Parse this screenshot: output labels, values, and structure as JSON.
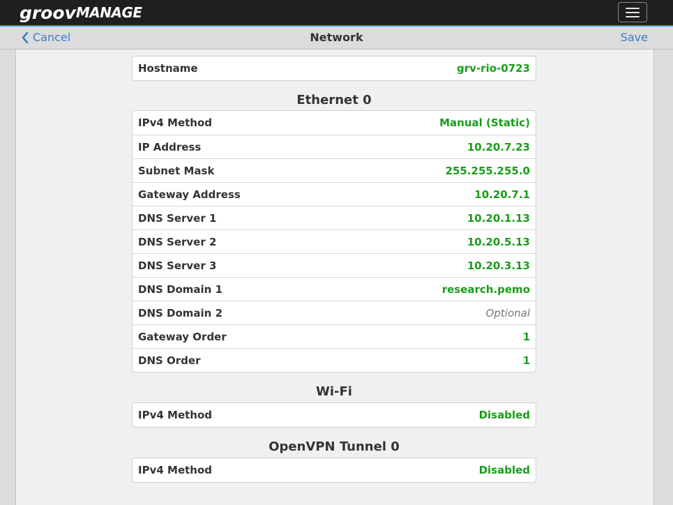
{
  "header": {
    "logo_part1": "groov",
    "logo_part2": "MANAGE"
  },
  "navbar": {
    "cancel_label": "Cancel",
    "title": "Network",
    "save_label": "Save"
  },
  "hostname": {
    "label": "Hostname",
    "value": "grv-rio-0723"
  },
  "ethernet": {
    "title": "Ethernet 0",
    "rows": [
      {
        "label": "IPv4 Method",
        "value": "Manual (Static)"
      },
      {
        "label": "IP Address",
        "value": "10.20.7.23"
      },
      {
        "label": "Subnet Mask",
        "value": "255.255.255.0"
      },
      {
        "label": "Gateway Address",
        "value": "10.20.7.1"
      },
      {
        "label": "DNS Server 1",
        "value": "10.20.1.13"
      },
      {
        "label": "DNS Server 2",
        "value": "10.20.5.13"
      },
      {
        "label": "DNS Server 3",
        "value": "10.20.3.13"
      },
      {
        "label": "DNS Domain 1",
        "value": "research.pemo"
      },
      {
        "label": "DNS Domain 2",
        "placeholder": "Optional"
      },
      {
        "label": "Gateway Order",
        "value": "1"
      },
      {
        "label": "DNS Order",
        "value": "1"
      }
    ]
  },
  "wifi": {
    "title": "Wi-Fi",
    "rows": [
      {
        "label": "IPv4 Method",
        "value": "Disabled"
      }
    ]
  },
  "openvpn": {
    "title": "OpenVPN Tunnel 0",
    "rows": [
      {
        "label": "IPv4 Method",
        "value": "Disabled"
      }
    ]
  },
  "colors": {
    "accent": "#3b7fc4",
    "value_green": "#1a9c1a",
    "topbar": "#1f1f1f"
  }
}
